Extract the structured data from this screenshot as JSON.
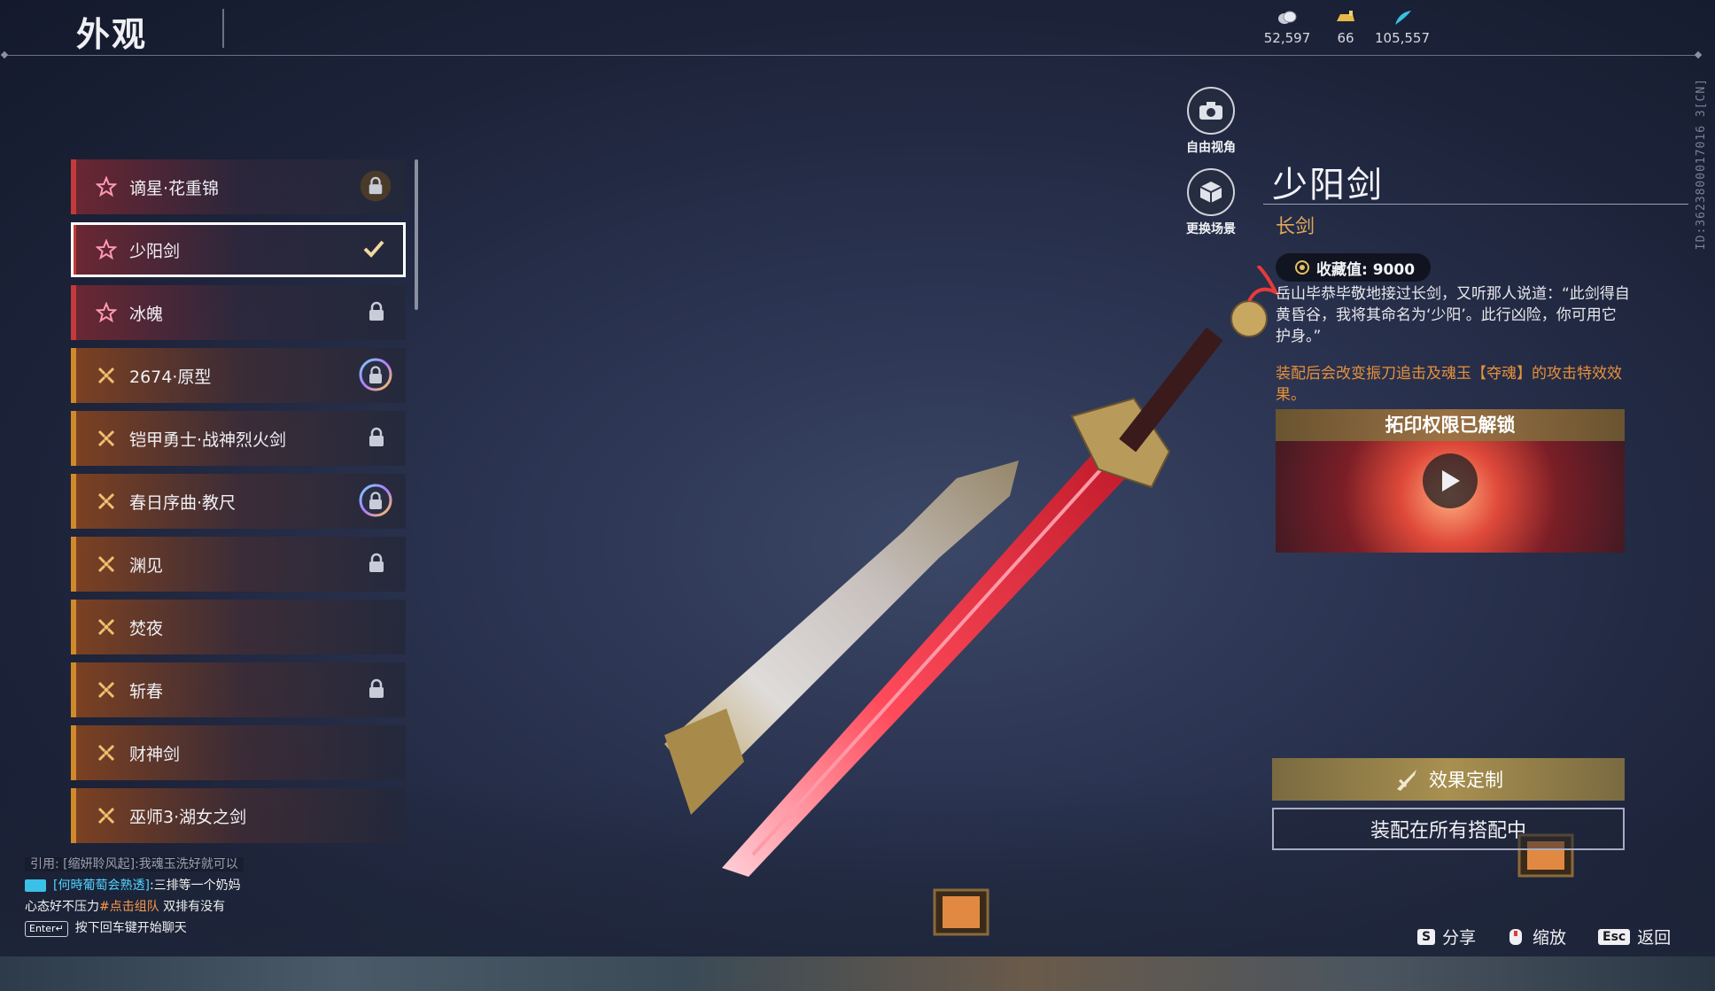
{
  "page": {
    "title": "外观"
  },
  "currencies": [
    {
      "icon": "coin-stack-icon",
      "value": "52,597"
    },
    {
      "icon": "gold-ingot-icon",
      "value": "66"
    },
    {
      "icon": "feather-icon",
      "value": "105,557"
    }
  ],
  "vertical_id": "ID:3623800017016 3[CN]",
  "tools": {
    "free_view": "自由视角",
    "change_scene": "更换场景"
  },
  "list": {
    "items": [
      {
        "label": "谪星·花重锦",
        "rarity": "red",
        "state": "locked-seal"
      },
      {
        "label": "少阳剑",
        "rarity": "red",
        "state": "equipped"
      },
      {
        "label": "冰魄",
        "rarity": "red",
        "state": "locked"
      },
      {
        "label": "2674·原型",
        "rarity": "gold",
        "state": "locked-ring"
      },
      {
        "label": "铠甲勇士·战神烈火剑",
        "rarity": "gold",
        "state": "locked"
      },
      {
        "label": "春日序曲·教尺",
        "rarity": "gold",
        "state": "locked-ring"
      },
      {
        "label": "渊见",
        "rarity": "gold",
        "state": "locked"
      },
      {
        "label": "焚夜",
        "rarity": "gold",
        "state": "none"
      },
      {
        "label": "斩春",
        "rarity": "gold",
        "state": "locked"
      },
      {
        "label": "财神剑",
        "rarity": "gold",
        "state": "none"
      },
      {
        "label": "巫师3·湖女之剑",
        "rarity": "gold",
        "state": "none"
      }
    ]
  },
  "chat": {
    "quote": "引用: [缩妍聆风起]:我魂玉洗好就可以",
    "line2_name": "[何時葡萄会熟透]",
    "line2_text": ":三排等一个奶妈",
    "line3_a": "心态好不压力",
    "line3_tag": "#点击组队",
    "line3_b": " 双排有没有",
    "enter_key": "Enter↵",
    "enter_hint": "按下回车键开始聊天"
  },
  "detail": {
    "name": "少阳剑",
    "type": "长剑",
    "collect_label": "收藏值: 9000",
    "description": "岳山毕恭毕敬地接过长剑，又听那人说道：“此剑得自黄昏谷，我将其命名为‘少阳’。此行凶险，你可用它护身。”",
    "effect": "装配后会改变振刀追击及魂玉【夺魂】的攻击特效效果。",
    "video_title": "拓印权限已解锁",
    "custom_button": "效果定制",
    "equip_button": "装配在所有搭配中"
  },
  "footer": {
    "share_key": "S",
    "share_label": "分享",
    "zoom_label": "缩放",
    "back_key": "Esc",
    "back_label": "返回"
  },
  "colors": {
    "accent_red": "#c23a3a",
    "accent_gold": "#d08a2a",
    "type_gold": "#e0a85a",
    "effect_orange": "#e8903a",
    "chat_cyan": "#4fd4ff"
  }
}
